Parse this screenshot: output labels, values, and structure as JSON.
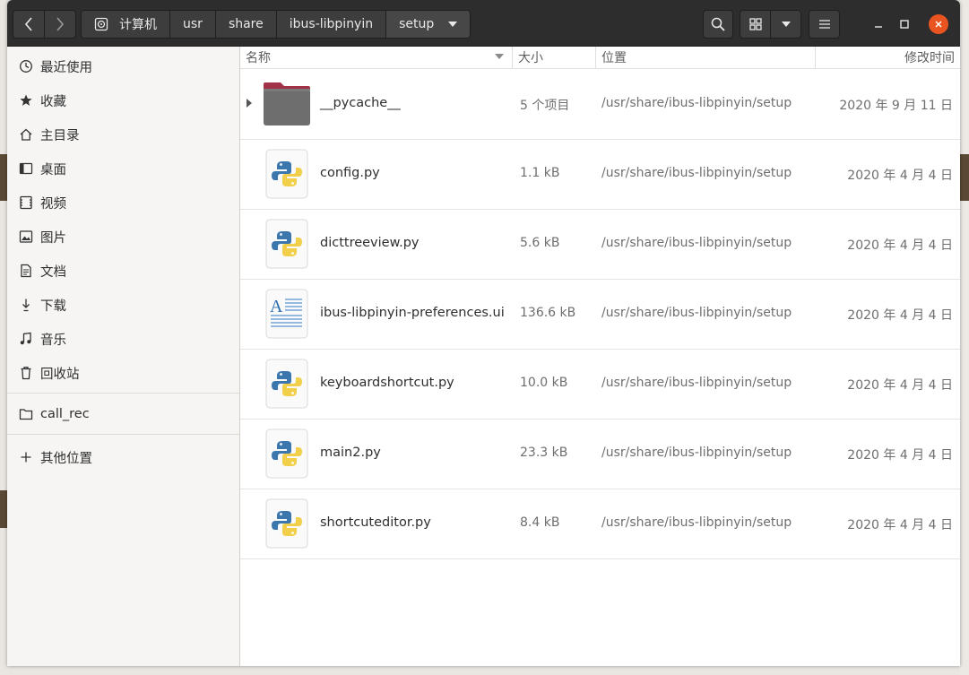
{
  "header": {
    "breadcrumbs": [
      {
        "label": "计算机",
        "icon": "disk-icon"
      },
      {
        "label": "usr"
      },
      {
        "label": "share"
      },
      {
        "label": "ibus-libpinyin"
      },
      {
        "label": "setup",
        "active": true
      }
    ]
  },
  "sidebar": {
    "items": [
      {
        "label": "最近使用",
        "icon": "clock-icon"
      },
      {
        "label": "收藏",
        "icon": "star-icon"
      },
      {
        "label": "主目录",
        "icon": "home-icon"
      },
      {
        "label": "桌面",
        "icon": "desktop-icon"
      },
      {
        "label": "视频",
        "icon": "video-icon"
      },
      {
        "label": "图片",
        "icon": "picture-icon"
      },
      {
        "label": "文档",
        "icon": "document-icon"
      },
      {
        "label": "下载",
        "icon": "download-icon"
      },
      {
        "label": "音乐",
        "icon": "music-icon"
      },
      {
        "label": "回收站",
        "icon": "trash-icon"
      }
    ],
    "bookmarks": [
      {
        "label": "call_rec",
        "icon": "folder-icon"
      }
    ],
    "other": {
      "label": "其他位置",
      "icon": "plus-icon"
    }
  },
  "columns": {
    "name": "名称",
    "size": "大小",
    "location": "位置",
    "modified": "修改时间"
  },
  "files": [
    {
      "name": "__pycache__",
      "size": "5 个项目",
      "location": "/usr/share/ibus-libpinyin/setup",
      "modified": "2020 年 9 月 11 日",
      "type": "folder"
    },
    {
      "name": "config.py",
      "size": "1.1 kB",
      "location": "/usr/share/ibus-libpinyin/setup",
      "modified": "2020 年 4 月 4 日",
      "type": "python"
    },
    {
      "name": "dicttreeview.py",
      "size": "5.6 kB",
      "location": "/usr/share/ibus-libpinyin/setup",
      "modified": "2020 年 4 月 4 日",
      "type": "python"
    },
    {
      "name": "ibus-libpinyin-preferences.ui",
      "size": "136.6 kB",
      "location": "/usr/share/ibus-libpinyin/setup",
      "modified": "2020 年 4 月 4 日",
      "type": "text"
    },
    {
      "name": "keyboardshortcut.py",
      "size": "10.0 kB",
      "location": "/usr/share/ibus-libpinyin/setup",
      "modified": "2020 年 4 月 4 日",
      "type": "python"
    },
    {
      "name": "main2.py",
      "size": "23.3 kB",
      "location": "/usr/share/ibus-libpinyin/setup",
      "modified": "2020 年 4 月 4 日",
      "type": "python"
    },
    {
      "name": "shortcuteditor.py",
      "size": "8.4 kB",
      "location": "/usr/share/ibus-libpinyin/setup",
      "modified": "2020 年 4 月 4 日",
      "type": "python"
    }
  ],
  "colors": {
    "header_bg": "#2d2d2d",
    "close_button": "#e95420",
    "sidebar_bg": "#f6f5f4",
    "folder_tab": "#a0324a"
  }
}
